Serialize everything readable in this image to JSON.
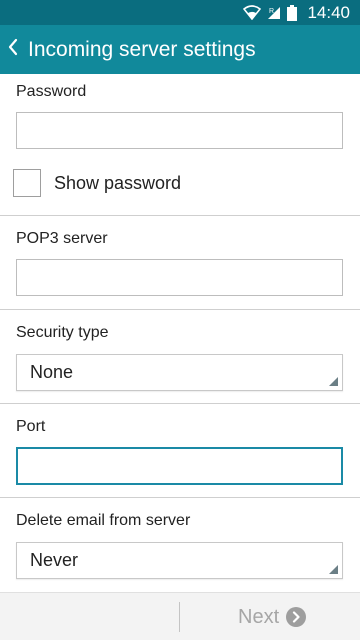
{
  "status_bar": {
    "time": "14:40",
    "icons": [
      "wifi-icon",
      "signal-icon",
      "battery-icon"
    ]
  },
  "action_bar": {
    "back_icon": "chevron-left-icon",
    "title": "Incoming server settings"
  },
  "form": {
    "password": {
      "label": "Password",
      "value": ""
    },
    "show_password": {
      "label": "Show password",
      "checked": false
    },
    "pop3_server": {
      "label": "POP3 server",
      "value": ""
    },
    "security_type": {
      "label": "Security type",
      "value": "None"
    },
    "port": {
      "label": "Port",
      "value": "",
      "focused": true
    },
    "delete_email": {
      "label": "Delete email from server",
      "value": "Never"
    }
  },
  "bottom_bar": {
    "next_label": "Next",
    "next_icon": "chevron-right-circle-icon",
    "next_enabled": false
  },
  "colors": {
    "status_bar": "#0a6d7f",
    "action_bar": "#11899b",
    "focus_border": "#1a8aa6",
    "disabled_text": "#a6a6a6"
  }
}
